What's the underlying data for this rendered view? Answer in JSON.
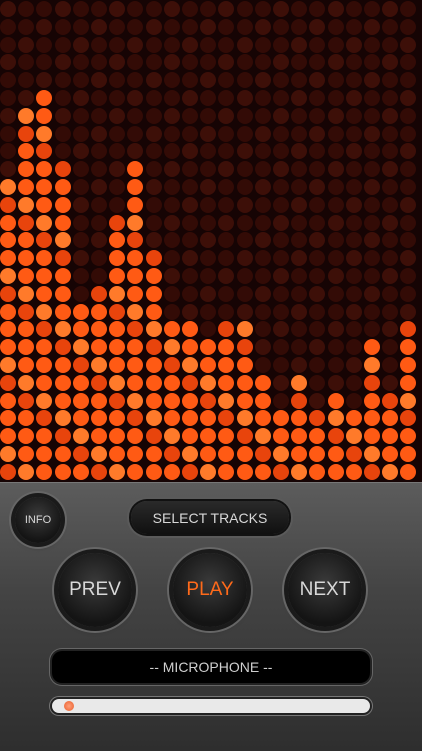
{
  "visualizer": {
    "levels": [
      17,
      21,
      22,
      18,
      10,
      11,
      15,
      18,
      13,
      9,
      9,
      8,
      9,
      9,
      6,
      4,
      6,
      4,
      5,
      4,
      8,
      5,
      9
    ],
    "colors": {
      "lit": "#ff5a14",
      "lit_hot": "#ff7a2a",
      "lit_dim": "#e8440c",
      "unlit": "#330b06",
      "unlit_alt": "#3d0f08",
      "background": "#160404"
    }
  },
  "controls": {
    "info_label": "INFO",
    "select_tracks_label": "SELECT TRACKS",
    "prev_label": "PREV",
    "play_label": "PLAY",
    "next_label": "NEXT",
    "play_color": "#ff6a1a",
    "source_label": "-- MICROPHONE --",
    "progress_fraction": 0.02
  }
}
